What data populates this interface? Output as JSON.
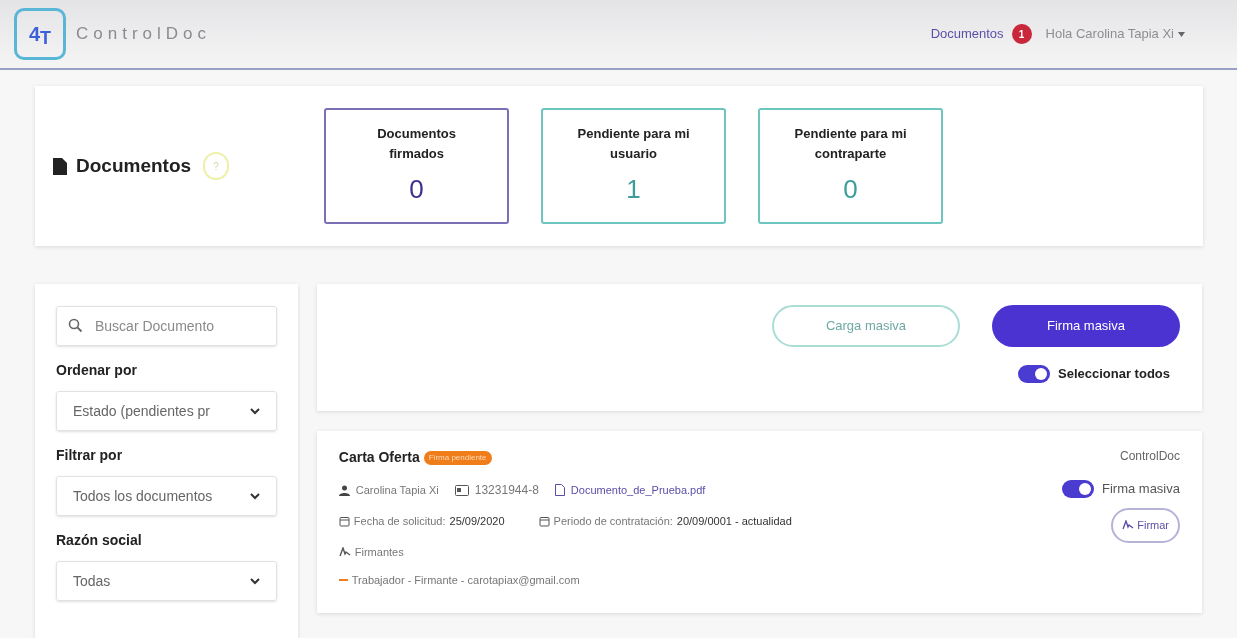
{
  "header": {
    "logo": {
      "main": "4",
      "sub": "T"
    },
    "brand": "ControlDoc",
    "nav_link": "Documentos",
    "nav_badge": "1",
    "user_menu": "Hola Carolina Tapia Xi"
  },
  "summary": {
    "title": "Documentos",
    "help": "?",
    "stats": [
      {
        "label": "Documentos firmados",
        "value": "0",
        "color": "#7b6fb5"
      },
      {
        "label": "Pendiente para mi usuario",
        "value": "1",
        "color": "#6cc5bf"
      },
      {
        "label": "Pendiente para mi contraparte",
        "value": "0",
        "color": "#6cc5bf"
      }
    ]
  },
  "sidebar": {
    "search": {
      "placeholder": "Buscar Documento"
    },
    "filters": [
      {
        "label": "Ordenar por",
        "value": "Estado (pendientes pr"
      },
      {
        "label": "Filtrar por",
        "value": "Todos los documentos"
      },
      {
        "label": "Razón social",
        "value": "Todas"
      }
    ]
  },
  "actions": {
    "buttons": [
      {
        "label": "Carga masiva",
        "kind": "outline"
      },
      {
        "label": "Firma masiva",
        "kind": "primary"
      }
    ],
    "select_all": {
      "label": "Seleccionar todos",
      "on": true
    }
  },
  "documents": [
    {
      "title": "Carta Oferta",
      "status": "Firma pendiente",
      "company": "ControlDoc",
      "person": "Carolina Tapia Xi",
      "rut": "13231944-8",
      "file": "Documento_de_Prueba.pdf",
      "request_label": "Fecha de solicitud:",
      "request_date": "25/09/2020",
      "period_label": "Periodo de contratación:",
      "period": "20/09/0001 - actualidad",
      "signers_label": "Firmantes",
      "signers": [
        "Trabajador - Firmante - carotapiax@gmail.com"
      ],
      "bulk": {
        "label": "Firma masiva",
        "on": true
      },
      "sign_button": "Firmar"
    }
  ]
}
